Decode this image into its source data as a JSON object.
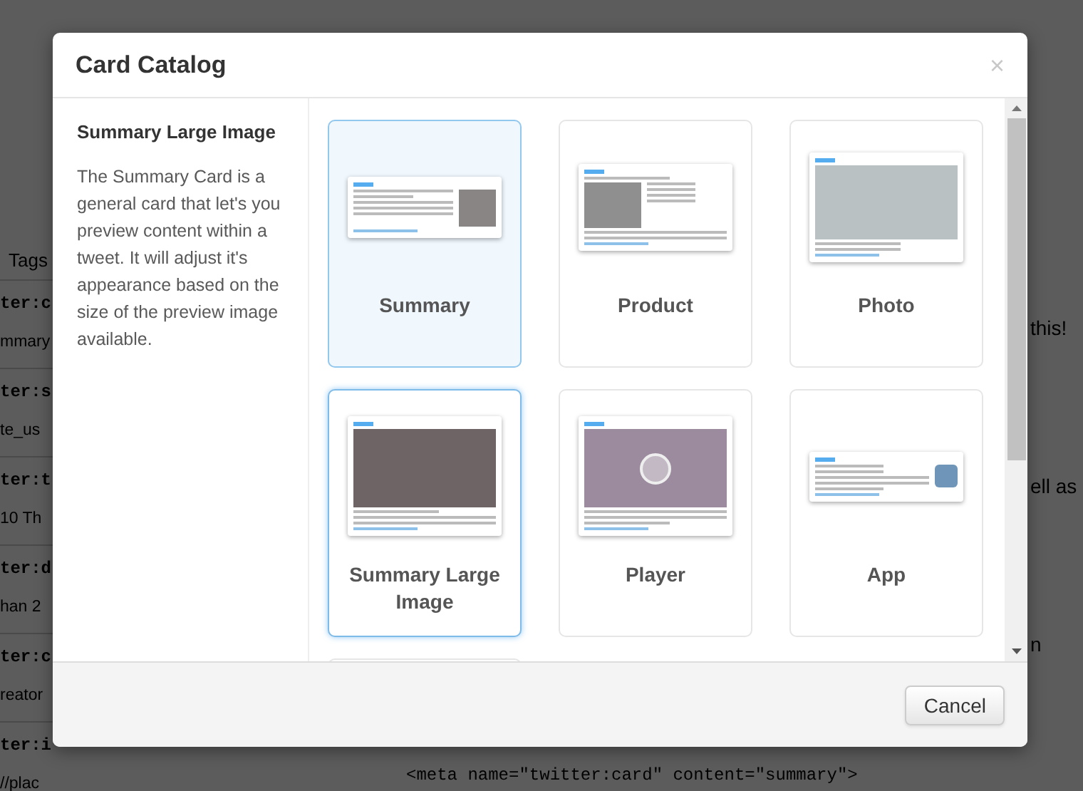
{
  "background_page": {
    "section_label": "Tags",
    "fields": [
      {
        "label": "ter:c",
        "value": "mmary"
      },
      {
        "label": "ter:s",
        "value": "te_us"
      },
      {
        "label": "ter:t",
        "value": "10 Th"
      },
      {
        "label": "ter:d",
        "value": "han 2"
      },
      {
        "label": "ter:c",
        "value": "reator"
      },
      {
        "label": "ter:i",
        "value": "//plac"
      }
    ],
    "right_texts": [
      "this!",
      "ell as",
      "n"
    ],
    "code": "<meta name=\"twitter:card\" content=\"summary\">"
  },
  "dialog": {
    "title": "Card Catalog",
    "close": "×",
    "sidebar": {
      "heading": "Summary Large Image",
      "description": "The Summary Card is a general card that let's you preview content within a tweet. It will adjust it's appearance based on the size of the preview image available."
    },
    "cards": [
      {
        "kind": "summary",
        "label": "Summary",
        "selected": false,
        "highlighted": true
      },
      {
        "kind": "product",
        "label": "Product",
        "selected": false,
        "highlighted": false
      },
      {
        "kind": "photo",
        "label": "Photo",
        "selected": false,
        "highlighted": false
      },
      {
        "kind": "summary_large_image",
        "label": "Summary Large Image",
        "selected": true,
        "highlighted": false
      },
      {
        "kind": "player",
        "label": "Player",
        "selected": false,
        "highlighted": false
      },
      {
        "kind": "app",
        "label": "App",
        "selected": false,
        "highlighted": false
      },
      {
        "kind": "partial",
        "selected": false,
        "highlighted": false
      }
    ],
    "cancel_button": "Cancel"
  }
}
